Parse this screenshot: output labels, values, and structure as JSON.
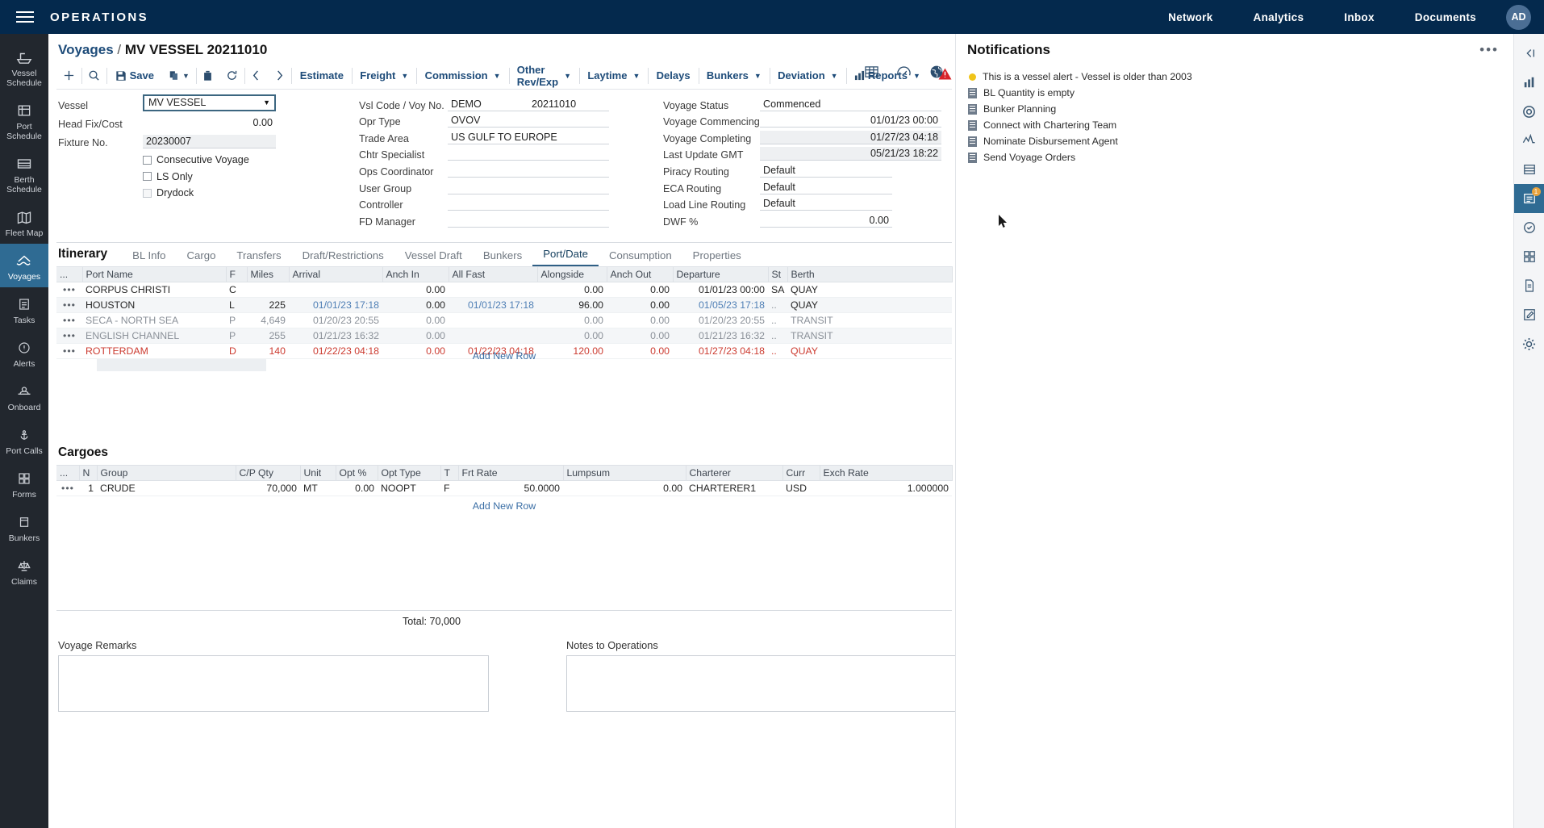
{
  "topbar": {
    "menu_icon": "hamburger-icon",
    "app_title": "OPERATIONS",
    "nav": [
      {
        "label": "Network"
      },
      {
        "label": "Analytics"
      },
      {
        "label": "Inbox"
      },
      {
        "label": "Documents"
      }
    ],
    "avatar_initials": "AD"
  },
  "left_rail": [
    {
      "icon": "vessel-schedule-icon",
      "label": "Vessel\nSchedule",
      "active": false
    },
    {
      "icon": "port-schedule-icon",
      "label": "Port\nSchedule",
      "active": false
    },
    {
      "icon": "berth-schedule-icon",
      "label": "Berth\nSchedule",
      "active": false
    },
    {
      "icon": "fleet-map-icon",
      "label": "Fleet Map",
      "active": false
    },
    {
      "icon": "voyages-icon",
      "label": "Voyages",
      "active": true
    },
    {
      "icon": "tasks-icon",
      "label": "Tasks",
      "active": false
    },
    {
      "icon": "alerts-icon",
      "label": "Alerts",
      "active": false
    },
    {
      "icon": "onboard-icon",
      "label": "Onboard",
      "active": false
    },
    {
      "icon": "port-calls-icon",
      "label": "Port Calls",
      "active": false
    },
    {
      "icon": "forms-icon",
      "label": "Forms",
      "active": false
    },
    {
      "icon": "bunkers-icon",
      "label": "Bunkers",
      "active": false
    },
    {
      "icon": "claims-icon",
      "label": "Claims",
      "active": false
    }
  ],
  "right_rail": [
    {
      "icon": "collapse-panel-icon",
      "badge": ""
    },
    {
      "icon": "analytics-chart-icon",
      "badge": ""
    },
    {
      "icon": "lifebuoy-icon",
      "badge": ""
    },
    {
      "icon": "activity-icon",
      "badge": ""
    },
    {
      "icon": "list-view-icon",
      "badge": ""
    },
    {
      "icon": "notifications-icon",
      "badge": "1"
    },
    {
      "icon": "edit-note-icon",
      "badge": ""
    },
    {
      "icon": "grid-apps-icon",
      "badge": ""
    },
    {
      "icon": "document-icon",
      "badge": ""
    },
    {
      "icon": "compose-icon",
      "badge": ""
    },
    {
      "icon": "settings-gear-icon",
      "badge": ""
    }
  ],
  "page": {
    "breadcrumb_root": "Voyages",
    "breadcrumb_sep": "/",
    "breadcrumb_current": "MV VESSEL 20211010",
    "head_icons": [
      {
        "icon": "grid-table-icon"
      },
      {
        "icon": "gauge-dashboard-icon"
      },
      {
        "icon": "globe-icon"
      }
    ]
  },
  "toolbar": {
    "add_label": "",
    "search_label": "",
    "save_label": "Save",
    "copy_label": "",
    "delete_label": "",
    "refresh_label": "",
    "prev_label": "",
    "next_label": "",
    "items": [
      {
        "label": "Estimate",
        "caret": false
      },
      {
        "label": "Freight",
        "caret": true
      },
      {
        "label": "Commission",
        "caret": true
      },
      {
        "label": "Other Rev/Exp",
        "caret": true
      },
      {
        "label": "Laytime",
        "caret": true
      },
      {
        "label": "Delays",
        "caret": false
      },
      {
        "label": "Bunkers",
        "caret": true
      },
      {
        "label": "Deviation",
        "caret": true
      },
      {
        "label": "Reports",
        "caret": true
      }
    ],
    "warning_icon": "warning-triangle-icon"
  },
  "form": {
    "col1": [
      {
        "label": "Vessel",
        "value": "MV VESSEL",
        "type": "select"
      },
      {
        "label": "Head Fix/Cost",
        "value": "0.00",
        "type": "number"
      },
      {
        "label": "Fixture No.",
        "value": "20230007",
        "type": "readonly"
      }
    ],
    "checkboxes": [
      {
        "label": "Consecutive Voyage",
        "checked": false,
        "disabled": false
      },
      {
        "label": "LS Only",
        "checked": false,
        "disabled": false
      },
      {
        "label": "Drydock",
        "checked": false,
        "disabled": true
      }
    ],
    "col2": [
      {
        "label": "Vsl Code / Voy No.",
        "value": "DEMO",
        "value2": "20211010"
      },
      {
        "label": "Opr Type",
        "value": "OVOV",
        "value2": ""
      },
      {
        "label": "Trade Area",
        "value": "US GULF TO EUROPE",
        "value2": ""
      },
      {
        "label": "Chtr Specialist",
        "value": "",
        "value2": ""
      },
      {
        "label": "Ops Coordinator",
        "value": "",
        "value2": ""
      },
      {
        "label": "User Group",
        "value": "",
        "value2": ""
      },
      {
        "label": "Controller",
        "value": "",
        "value2": ""
      },
      {
        "label": "FD Manager",
        "value": "",
        "value2": ""
      }
    ],
    "col3": [
      {
        "label": "Voyage Status",
        "value": "Commenced",
        "value2": "",
        "align": "left",
        "grey": false
      },
      {
        "label": "Voyage Commencing",
        "value": "",
        "value2": "01/01/23 00:00",
        "align": "right",
        "grey": false
      },
      {
        "label": "Voyage Completing",
        "value": "",
        "value2": "01/27/23 04:18",
        "align": "right",
        "grey": true
      },
      {
        "label": "Last Update GMT",
        "value": "",
        "value2": "05/21/23 18:22",
        "align": "right",
        "grey": true
      },
      {
        "label": "Piracy Routing",
        "value": "Default",
        "value2": "",
        "align": "left",
        "grey": false
      },
      {
        "label": "ECA Routing",
        "value": "Default",
        "value2": "",
        "align": "left",
        "grey": false
      },
      {
        "label": "Load Line Routing",
        "value": "Default",
        "value2": "",
        "align": "left",
        "grey": false
      },
      {
        "label": "DWF %",
        "value": "",
        "value2": "0.00",
        "align": "right",
        "grey": false
      }
    ]
  },
  "itinerary": {
    "tabs": [
      {
        "label": "Itinerary",
        "primary": true,
        "selected": false
      },
      {
        "label": "BL Info",
        "primary": false,
        "selected": false
      },
      {
        "label": "Cargo",
        "primary": false,
        "selected": false
      },
      {
        "label": "Transfers",
        "primary": false,
        "selected": false
      },
      {
        "label": "Draft/Restrictions",
        "primary": false,
        "selected": false
      },
      {
        "label": "Vessel Draft",
        "primary": false,
        "selected": false
      },
      {
        "label": "Bunkers",
        "primary": false,
        "selected": false
      },
      {
        "label": "Port/Date",
        "primary": false,
        "selected": true
      },
      {
        "label": "Consumption",
        "primary": false,
        "selected": false
      },
      {
        "label": "Properties",
        "primary": false,
        "selected": false
      }
    ],
    "columns": [
      "...",
      "Port Name",
      "F",
      "Miles",
      "Arrival",
      "Anch In",
      "All Fast",
      "Alongside",
      "Anch Out",
      "Departure",
      "St",
      "Berth"
    ],
    "rows": [
      {
        "menu": "•••",
        "port": "CORPUS CHRISTI",
        "f": "C",
        "miles": "",
        "arrival": "",
        "anch_in": "0.00",
        "all_fast": "",
        "alongside": "0.00",
        "anch_out": "0.00",
        "departure": "01/01/23 00:00",
        "st": "SA",
        "berth": "QUAY",
        "style": "normal"
      },
      {
        "menu": "•••",
        "port": "HOUSTON",
        "f": "L",
        "miles": "225",
        "arrival": "01/01/23 17:18",
        "anch_in": "0.00",
        "all_fast": "01/01/23 17:18",
        "alongside": "96.00",
        "anch_out": "0.00",
        "departure": "01/05/23 17:18",
        "st": "..",
        "berth": "QUAY",
        "style": "blue"
      },
      {
        "menu": "•••",
        "port": "SECA - NORTH SEA",
        "f": "P",
        "miles": "4,649",
        "arrival": "01/20/23 20:55",
        "anch_in": "0.00",
        "all_fast": "",
        "alongside": "0.00",
        "anch_out": "0.00",
        "departure": "01/20/23 20:55",
        "st": "..",
        "berth": "TRANSIT",
        "style": "muted"
      },
      {
        "menu": "•••",
        "port": "ENGLISH CHANNEL",
        "f": "P",
        "miles": "255",
        "arrival": "01/21/23 16:32",
        "anch_in": "0.00",
        "all_fast": "",
        "alongside": "0.00",
        "anch_out": "0.00",
        "departure": "01/21/23 16:32",
        "st": "..",
        "berth": "TRANSIT",
        "style": "muted"
      },
      {
        "menu": "•••",
        "port": "ROTTERDAM",
        "f": "D",
        "miles": "140",
        "arrival": "01/22/23 04:18",
        "anch_in": "0.00",
        "all_fast": "01/22/23 04:18",
        "alongside": "120.00",
        "anch_out": "0.00",
        "departure": "01/27/23 04:18",
        "st": "..",
        "berth": "QUAY",
        "style": "red"
      }
    ],
    "add_row_label": "Add New Row"
  },
  "cargoes": {
    "title": "Cargoes",
    "columns": [
      "...",
      "N",
      "Group",
      "C/P Qty",
      "Unit",
      "Opt %",
      "Opt Type",
      "T",
      "Frt Rate",
      "Lumpsum",
      "Charterer",
      "Curr",
      "Exch Rate"
    ],
    "rows": [
      {
        "menu": "•••",
        "n": "1",
        "group": "CRUDE",
        "cp_qty": "70,000",
        "unit": "MT",
        "opt_pct": "0.00",
        "opt_type": "NOOPT",
        "t": "F",
        "frt_rate": "50.0000",
        "lumpsum": "0.00",
        "charterer": "CHARTERER1",
        "curr": "USD",
        "exch_rate": "1.000000"
      }
    ],
    "add_row_label": "Add New Row",
    "total_label": "Total: 70,000"
  },
  "remarks": {
    "voyage_remarks_label": "Voyage Remarks",
    "voyage_remarks_value": "",
    "notes_label": "Notes to Operations",
    "notes_value": ""
  },
  "notifications": {
    "title": "Notifications",
    "more_icon": "more-options-icon",
    "items": [
      {
        "icon": "alert-dot-icon",
        "text": "This is a vessel alert - Vessel is older than 2003"
      },
      {
        "icon": "task-doc-icon",
        "text": "BL Quantity is empty"
      },
      {
        "icon": "task-doc-icon",
        "text": "Bunker Planning"
      },
      {
        "icon": "task-doc-icon",
        "text": "Connect with Chartering Team"
      },
      {
        "icon": "task-doc-icon",
        "text": "Nominate Disbursement Agent"
      },
      {
        "icon": "task-doc-icon",
        "text": "Send Voyage Orders"
      }
    ]
  }
}
